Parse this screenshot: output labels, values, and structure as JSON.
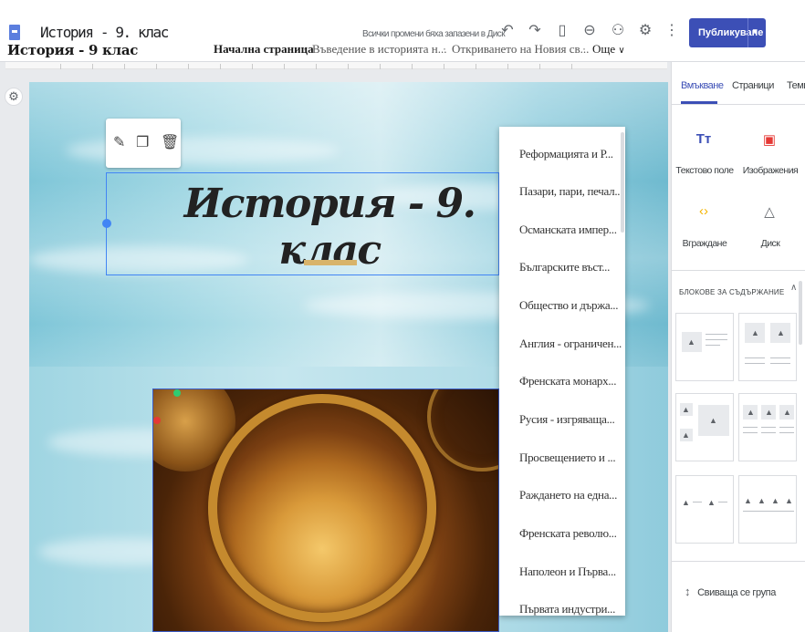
{
  "app": {
    "title": "История - 9. клас",
    "save_status": "Всички промени бяха запазени в Диск",
    "publish_label": "Публикуване",
    "publish_dropdown_icon": "▾",
    "toolbar_icons": [
      "undo-icon",
      "redo-icon",
      "preview-icon",
      "link-icon",
      "share-icon",
      "settings-icon",
      "more-icon"
    ]
  },
  "site": {
    "name": "История - 9 клас",
    "nav": [
      "Начална страница",
      "Въведение в историята н...",
      "Откриването на Новия св...",
      "Още"
    ],
    "heading": "История - 9. клас",
    "edit_tools": [
      "pencil-icon",
      "copy-icon",
      "delete-icon"
    ],
    "more_menu": [
      "Реформацията и Р...",
      "Пазари, пари, печал...",
      "Османската импер...",
      "Българските въст...",
      "Общество и държа...",
      "Англия - ограничен...",
      "Френската монарх...",
      "Русия - изгряваща...",
      "Просвещението и ...",
      "Раждането на една...",
      "Френската револю...",
      "Наполеон и Първа...",
      "Първата индустри..."
    ]
  },
  "sidepanel": {
    "tabs": [
      "Вмъкване",
      "Страници",
      "Теми"
    ],
    "active_tab": "Вмъкване",
    "insert_items": [
      {
        "label": "Текстово поле",
        "icon": "text-box-icon"
      },
      {
        "label": "Изображения",
        "icon": "image-icon"
      },
      {
        "label": "Вграждане",
        "icon": "embed-icon"
      },
      {
        "label": "Диск",
        "icon": "drive-icon"
      }
    ],
    "blocks_header": "БЛОКОВЕ ЗА СЪДЪРЖАНИЕ",
    "collapse_group": "Свиваща се група"
  },
  "colors": {
    "accent": "#3c4fb6",
    "selection": "#4285f4",
    "heading_bar": "#d8b46a"
  }
}
